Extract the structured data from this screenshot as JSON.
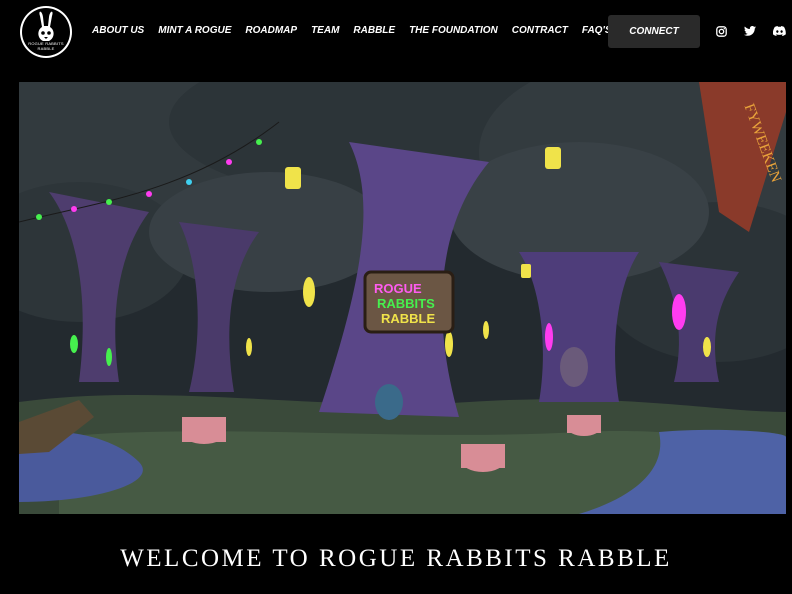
{
  "logo": {
    "text": "ROGUE RABBITS RABBLE"
  },
  "nav": {
    "items": [
      "ABOUT US",
      "MINT A ROGUE",
      "ROADMAP",
      "TEAM",
      "RABBLE",
      "THE FOUNDATION",
      "CONTRACT",
      "FAQ'S"
    ]
  },
  "connect": {
    "label": "CONNECT"
  },
  "social": [
    "instagram-icon",
    "twitter-icon",
    "discord-icon"
  ],
  "hero": {
    "sign": {
      "line1": "ROGUE",
      "line2": "RABBITS",
      "line3": "RABBLE"
    },
    "banner": "FYWEEKEN"
  },
  "welcome": {
    "title": "WELCOME TO ROGUE RABBITS RABBLE"
  }
}
